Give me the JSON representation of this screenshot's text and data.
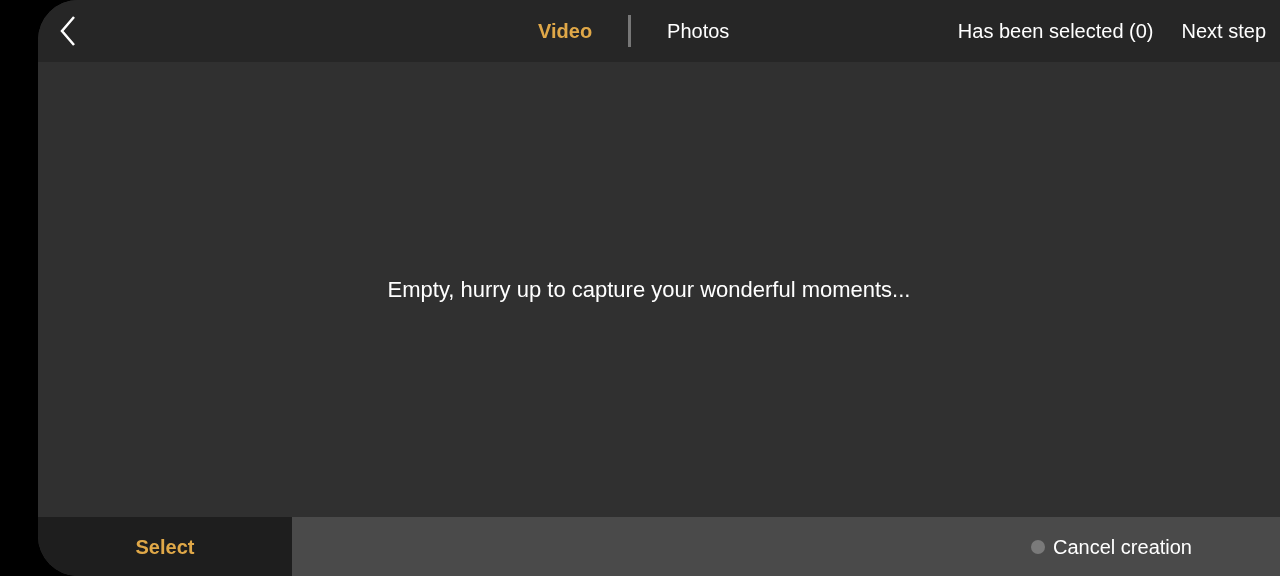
{
  "header": {
    "tabs": [
      {
        "label": "Video",
        "selected": true
      },
      {
        "label": "Photos",
        "selected": false
      }
    ],
    "selection_count": "Has been selected (0)",
    "next_button": "Next step"
  },
  "empty_message": "Empty, hurry up to capture your wonderful moments...",
  "footer": {
    "select_button": "Select",
    "cancel_button": "Cancel creation"
  }
}
